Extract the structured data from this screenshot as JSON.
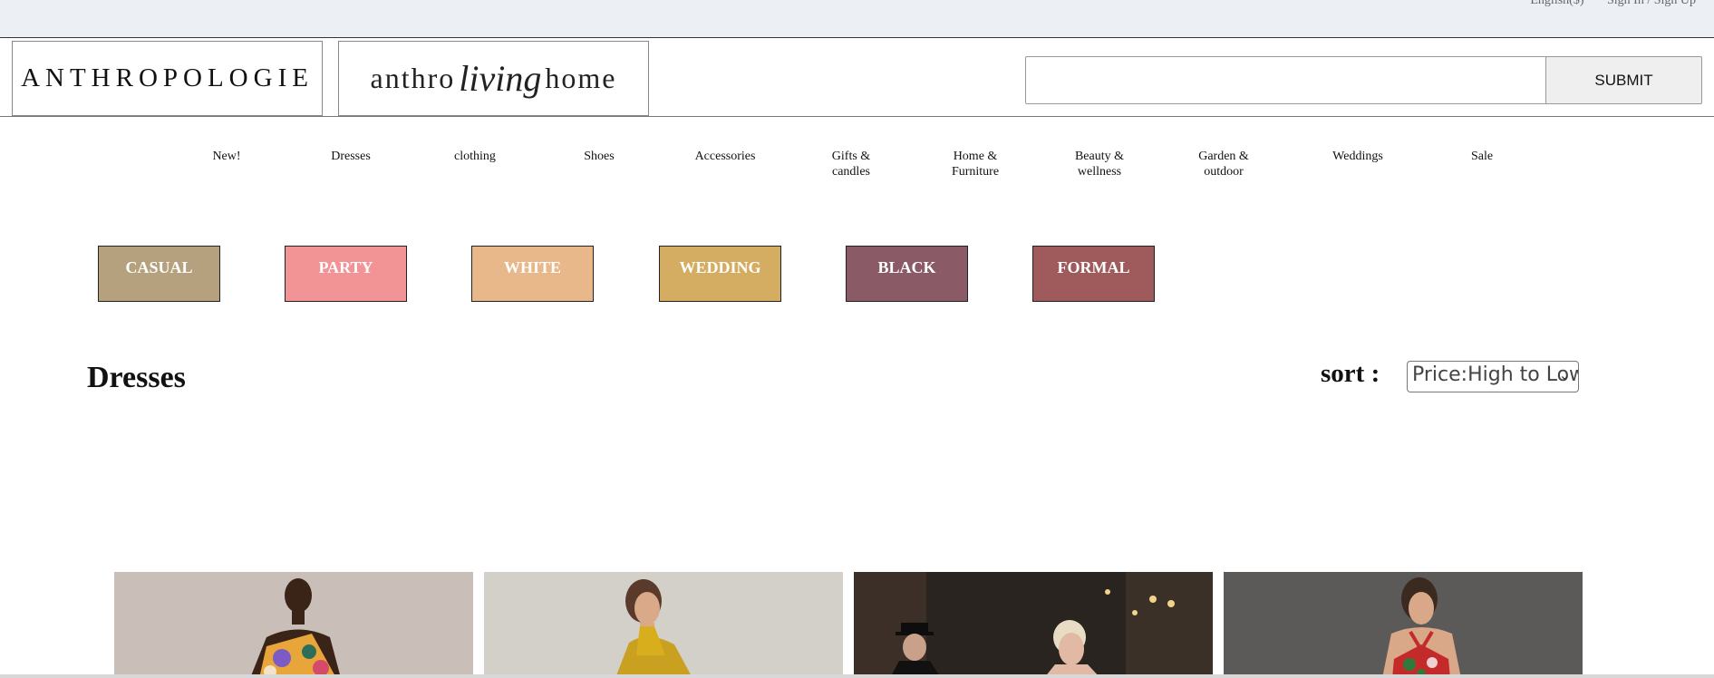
{
  "topbar": {
    "language": "English($)",
    "signin": "Sign In / Sign Up"
  },
  "header": {
    "logo_main": "ANTHROPOLOGIE",
    "logo_living": {
      "left": "anthro",
      "script": "living",
      "right": "home"
    },
    "search": {
      "value": "",
      "placeholder": ""
    },
    "submit_label": "SUBMIT"
  },
  "nav": {
    "items": [
      {
        "label": "New!"
      },
      {
        "label": "Dresses"
      },
      {
        "label": "clothing"
      },
      {
        "label": "Shoes"
      },
      {
        "label": "Accessories"
      },
      {
        "label": "Gifts & candles"
      },
      {
        "label": "Home & Furniture"
      },
      {
        "label": "Beauty & wellness"
      },
      {
        "label": "Garden & outdoor"
      },
      {
        "label": "Weddings"
      },
      {
        "label": "Sale"
      }
    ]
  },
  "filters": [
    {
      "label": "CASUAL",
      "color": "#b5a17e"
    },
    {
      "label": "PARTY",
      "color": "#f29496"
    },
    {
      "label": "WHITE",
      "color": "#e8b78a"
    },
    {
      "label": "WEDDING",
      "color": "#d4ac62"
    },
    {
      "label": "BLACK",
      "color": "#8a5a67"
    },
    {
      "label": "FORMAL",
      "color": "#9f5a5b"
    }
  ],
  "page": {
    "title": "Dresses"
  },
  "sort": {
    "label": "sort :",
    "selected": "Price:High to Low"
  },
  "products": [
    {
      "image": "model in floral one-shoulder dress"
    },
    {
      "image": "model in mustard halter dress"
    },
    {
      "image": "woman in evening street scene"
    },
    {
      "image": "model in red floral halter top"
    }
  ]
}
